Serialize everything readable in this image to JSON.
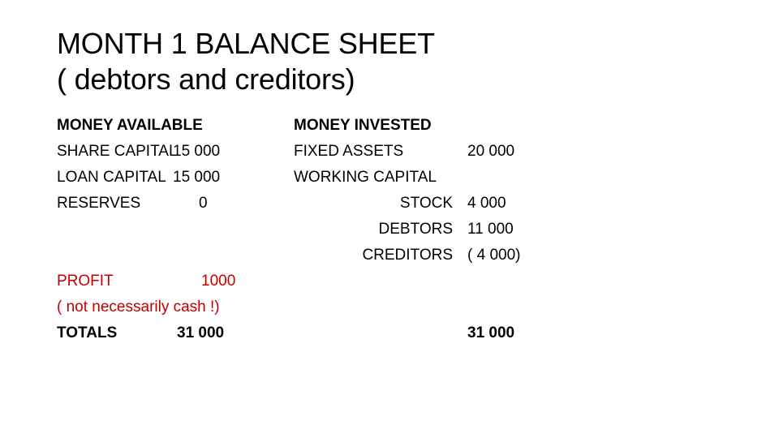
{
  "slide": {
    "background_color": "#FFFFFF",
    "title": {
      "line1": "MONTH 1 BALANCE SHEET",
      "line2": "( debtors and creditors)"
    },
    "colors": {
      "text": "#000000",
      "highlight_red": "#C00000"
    },
    "left_column": {
      "heading": "MONEY AVAILABLE",
      "rows": [
        {
          "label": "SHARE CAPITAL",
          "value": "15 000"
        },
        {
          "label": "LOAN CAPITAL",
          "value": "15 000"
        },
        {
          "label": "RESERVES",
          "value": "0"
        }
      ],
      "profit": {
        "label": "PROFIT",
        "value": "1000"
      },
      "profit_note": "( not necessarily cash !)",
      "total": {
        "label": "TOTALS",
        "value": "31 000"
      }
    },
    "right_column": {
      "heading": "MONEY INVESTED",
      "fixed_assets": {
        "label": "FIXED ASSETS",
        "value": "20 000"
      },
      "working_capital_heading": "WORKING CAPITAL",
      "working_capital_rows": [
        {
          "label": "STOCK",
          "value": "4 000"
        },
        {
          "label": "DEBTORS",
          "value": "11 000"
        },
        {
          "label": "CREDITORS",
          "value": "( 4 000)"
        }
      ],
      "total_value": "31 000"
    }
  }
}
